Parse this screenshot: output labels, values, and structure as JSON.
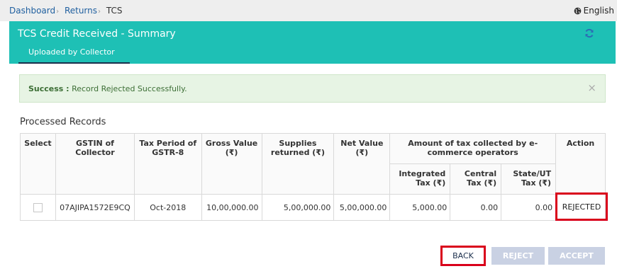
{
  "breadcrumb": {
    "items": [
      "Dashboard",
      "Returns"
    ],
    "current": "TCS"
  },
  "language": "English",
  "header": {
    "title": "TCS Credit Received - Summary",
    "tab": "Uploaded by Collector"
  },
  "alert": {
    "label": "Success :",
    "message": "Record Rejected Successfully."
  },
  "section_title": "Processed Records",
  "table": {
    "headers": {
      "select": "Select",
      "gstin": "GSTIN of Collector",
      "tax_period": "Tax Period of GSTR-8",
      "gross_value": "Gross Value (₹)",
      "supplies_returned": "Supplies returned (₹)",
      "net_value": "Net Value (₹)",
      "amount_group": "Amount of tax collected by e-commerce operators",
      "integrated_tax": "Integrated Tax (₹)",
      "central_tax": "Central Tax (₹)",
      "state_ut_tax": "State/UT Tax (₹)",
      "action": "Action"
    },
    "rows": [
      {
        "gstin": "07AJIPA1572E9CQ",
        "tax_period": "Oct-2018",
        "gross_value": "10,00,000.00",
        "supplies_returned": "5,00,000.00",
        "net_value": "5,00,000.00",
        "integrated_tax": "5,000.00",
        "central_tax": "0.00",
        "state_ut_tax": "0.00",
        "status": "REJECTED"
      }
    ]
  },
  "buttons": {
    "back": "BACK",
    "reject": "REJECT",
    "accept": "ACCEPT"
  },
  "colors": {
    "header_teal": "#1ec0b5",
    "highlight_red": "#d9001b",
    "disabled_button": "#c9d1e3",
    "success_bg": "#e7f4e4"
  }
}
